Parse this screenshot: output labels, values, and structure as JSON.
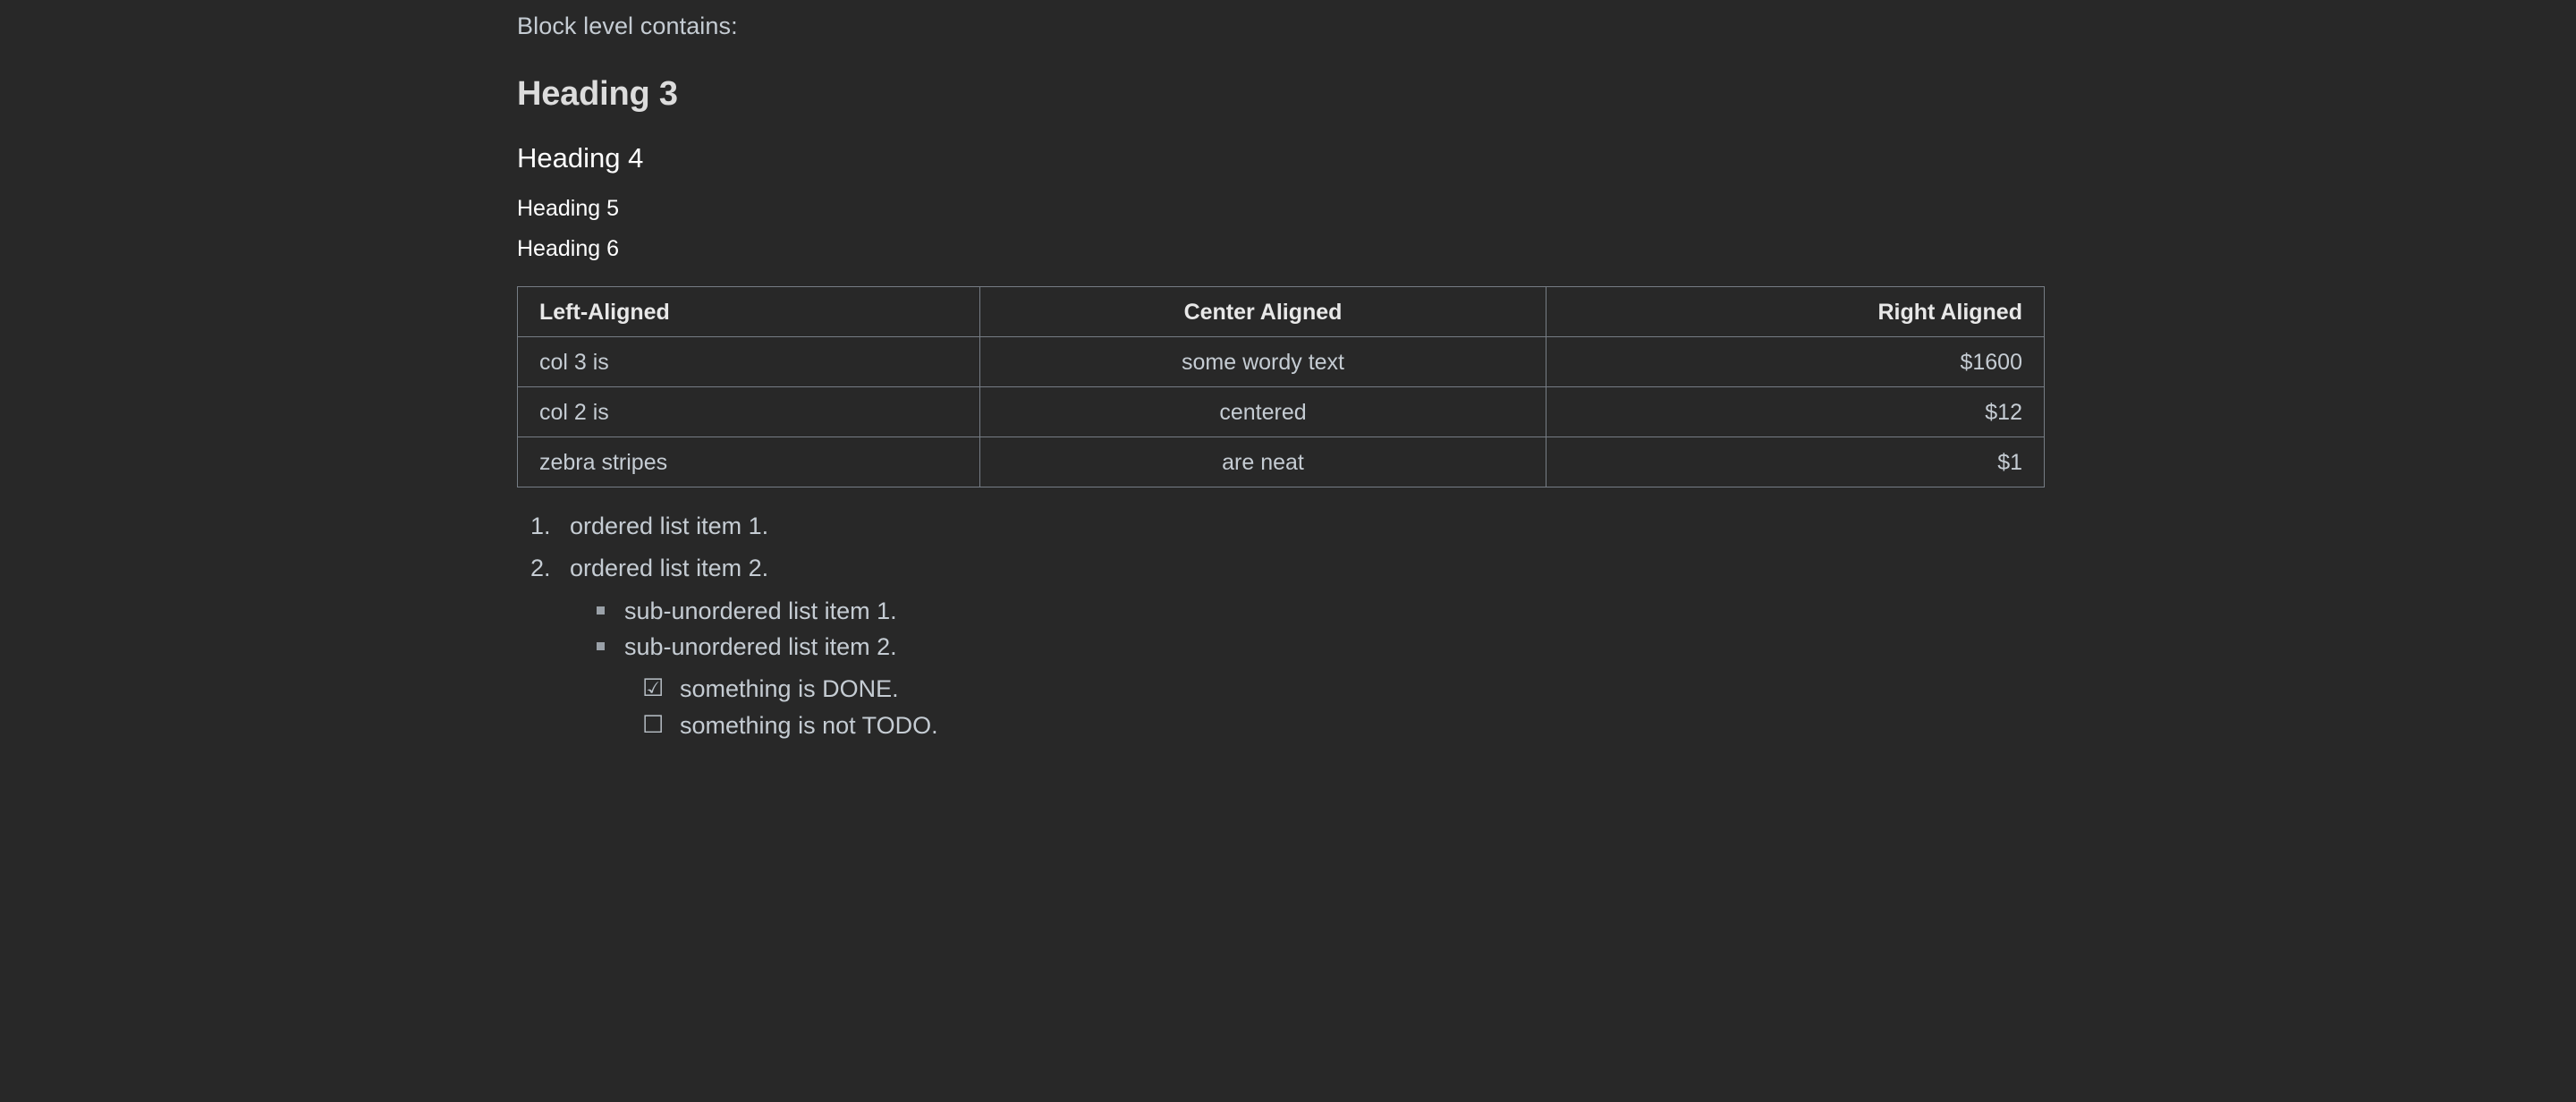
{
  "document": {
    "intro_line": "Block level contains:",
    "headings": {
      "h3": "Heading 3",
      "h4": "Heading 4",
      "h5": "Heading 5",
      "h6": "Heading 6"
    },
    "table": {
      "headers": [
        "Left-Aligned",
        "Center Aligned",
        "Right Aligned"
      ],
      "alignments": [
        "left",
        "center",
        "right"
      ],
      "rows": [
        [
          "col 3 is",
          "some wordy text",
          "$1600"
        ],
        [
          "col 2 is",
          "centered",
          "$12"
        ],
        [
          "zebra stripes",
          "are neat",
          "$1"
        ]
      ]
    },
    "ordered_list": [
      {
        "marker": "1.",
        "text": "ordered list item 1."
      },
      {
        "marker": "2.",
        "text": "ordered list item 2."
      }
    ],
    "sub_unordered_list": [
      {
        "bullet": "square-bullet-icon",
        "text": "sub-unordered list item 1."
      },
      {
        "bullet": "square-bullet-icon",
        "text": "sub-unordered list item 2."
      }
    ],
    "task_list": [
      {
        "checkbox": "☑",
        "checkbox_icon": "checkbox-checked-icon",
        "checked": true,
        "text": "something is DONE."
      },
      {
        "checkbox": "☐",
        "checkbox_icon": "checkbox-unchecked-icon",
        "checked": false,
        "text": "something is not TODO."
      }
    ]
  },
  "colors": {
    "background": "#282828",
    "body_text": "#c5ccd3",
    "heading_text": "#ffffff",
    "h3_text": "#dcdcdc",
    "table_border": "#767d85",
    "table_header_text": "#e8e8e8",
    "bullet": "#9aa1a8"
  }
}
